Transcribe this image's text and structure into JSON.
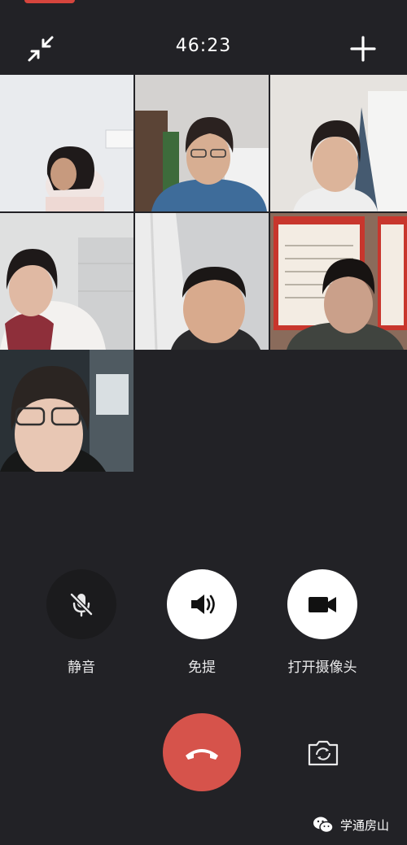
{
  "call": {
    "timer": "46:23"
  },
  "controls": {
    "mute_label": "静音",
    "speaker_label": "免提",
    "camera_label": "打开摄像头"
  },
  "watermark": {
    "text": "学通房山"
  },
  "icons": {
    "minimize": "minimize-arrows-icon",
    "add": "plus-icon",
    "mute": "mic-off-icon",
    "speaker": "speaker-icon",
    "camera": "video-camera-icon",
    "hangup": "phone-hangup-icon",
    "flip": "camera-flip-icon",
    "brand": "wechat-icon"
  },
  "colors": {
    "hangup": "#d6534b",
    "background": "#222226"
  }
}
